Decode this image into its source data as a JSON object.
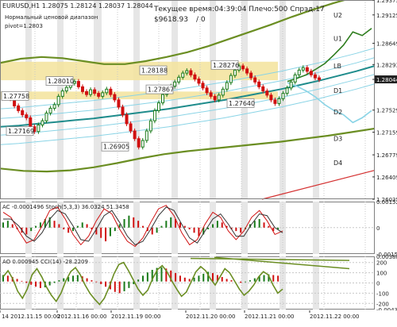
{
  "colors": {
    "bg": "#ffffff",
    "grid": "#c8c8c8",
    "shade": "#e6e6e6",
    "zone": "#f3e39b",
    "text": "#222222",
    "bull": "#1a7a1a",
    "bear": "#d01010",
    "olive": "#6b8e23",
    "teal": "#1f8c8c",
    "lightblue": "#8ad4e6",
    "red": "#d43030",
    "sep": "#808080"
  },
  "header": {
    "symbol_line": "EURUSD,H1  1.28075 1.28124 1.28037 1.28044",
    "indicator_title": "Нормальный ценовой диапазон",
    "pivot_line": "pivot=1.2803",
    "status_time": "Текущее время:04:39:04 Плечо:500 Спрэд:17",
    "balance": "$9618.93",
    "zero": "/ 0"
  },
  "chart_data": [
    {
      "type": "line",
      "title": "EURUSD,H1",
      "ylim": [
        1.26035,
        1.29375
      ],
      "y_ticks": [
        "1.29375",
        "1.29125",
        "1.28649",
        "1.28293",
        "1.28044",
        "1.27529",
        "1.27159",
        "1.26779",
        "1.26409",
        "1.26035"
      ],
      "current_price": "1.28044",
      "x_ticks": [
        "14 2012.11.15 00:00",
        "2012.11.16 00:00",
        "2012.11.19 00:00",
        "2012.11.20 00:00",
        "2012.11.21 00:00",
        "2012.11.22 00:00"
      ],
      "annotations": [
        {
          "label": "1.27758",
          "y": 1.2776
        },
        {
          "label": "1.28010",
          "y": 1.2801
        },
        {
          "label": "1.27169",
          "y": 1.2717
        },
        {
          "label": "1.28188",
          "y": 1.2819
        },
        {
          "label": "1.27867",
          "y": 1.2787
        },
        {
          "label": "1.28276",
          "y": 1.2828
        },
        {
          "label": "1.27640",
          "y": 1.2764
        },
        {
          "label": "1.26905",
          "y": 1.2691
        }
      ],
      "pivot_levels": [
        {
          "name": "U3",
          "y": 1.295
        },
        {
          "name": "U2",
          "y": 1.2912
        },
        {
          "name": "U1",
          "y": 1.2873
        },
        {
          "name": "LB",
          "y": 1.2827
        },
        {
          "name": "D1",
          "y": 1.2786
        },
        {
          "name": "D2",
          "y": 1.275
        },
        {
          "name": "D3",
          "y": 1.2705
        },
        {
          "name": "D4",
          "y": 1.2665
        }
      ],
      "price_zones": [
        {
          "from": 1.2803,
          "to": 1.2834
        },
        {
          "from": 1.2771,
          "to": 1.2784
        }
      ],
      "series": [
        {
          "role": "price",
          "values": [
            1.2775,
            1.2772,
            1.276,
            1.2752,
            1.2745,
            1.274,
            1.2725,
            1.2717,
            1.2728,
            1.2735,
            1.2748,
            1.2756,
            1.2762,
            1.2776,
            1.2785,
            1.2791,
            1.2798,
            1.2801,
            1.2792,
            1.2784,
            1.2779,
            1.2787,
            1.2781,
            1.2776,
            1.2782,
            1.2788,
            1.2779,
            1.277,
            1.2758,
            1.2745,
            1.273,
            1.2718,
            1.2705,
            1.2691,
            1.2702,
            1.2718,
            1.2735,
            1.2752,
            1.2765,
            1.2779,
            1.2787,
            1.2793,
            1.28,
            1.2808,
            1.2815,
            1.2819,
            1.2812,
            1.2805,
            1.2798,
            1.279,
            1.2782,
            1.2776,
            1.277,
            1.2778,
            1.2788,
            1.2799,
            1.2811,
            1.282,
            1.2827,
            1.2822,
            1.2815,
            1.2807,
            1.28,
            1.2792,
            1.2785,
            1.2778,
            1.277,
            1.2764,
            1.2772,
            1.2781,
            1.279,
            1.28,
            1.2812,
            1.282,
            1.2824,
            1.2818,
            1.2812,
            1.2807,
            1.2804
          ]
        },
        {
          "role": "projection_up",
          "values": [
            1.2801,
            1.2806,
            1.2812,
            1.2821,
            1.2831,
            1.2846,
            1.2862,
            1.2884,
            1.2878,
            1.289
          ]
        },
        {
          "role": "projection_down",
          "values": [
            1.2799,
            1.2793,
            1.2785,
            1.2775,
            1.2762,
            1.2752,
            1.2745,
            1.2732,
            1.274,
            1.2752
          ]
        },
        {
          "role": "ma_center",
          "values": [
            1.2725,
            1.2727,
            1.273,
            1.2733,
            1.2736,
            1.2739,
            1.2743,
            1.2747,
            1.2751,
            1.2755,
            1.276,
            1.2765,
            1.277,
            1.2776,
            1.2782,
            1.2788,
            1.2795,
            1.2802,
            1.281,
            1.2818,
            1.2827
          ]
        },
        {
          "role": "upper_band",
          "values": [
            1.2832,
            1.2839,
            1.2842,
            1.284,
            1.2835,
            1.283,
            1.283,
            1.2835,
            1.2842,
            1.285,
            1.286,
            1.2872,
            1.2884,
            1.2896,
            1.2909,
            1.2921,
            1.2932,
            1.2942,
            1.295
          ]
        },
        {
          "role": "lower_band",
          "values": [
            1.2655,
            1.2651,
            1.265,
            1.2652,
            1.2657,
            1.2664,
            1.2672,
            1.2679,
            1.2684,
            1.2688,
            1.2692,
            1.2696,
            1.27,
            1.2705,
            1.271,
            1.2716,
            1.2722
          ]
        }
      ]
    },
    {
      "type": "bar",
      "title": "AC -0.0001496  Stoch(5,3,3) 36.0324 51.3458",
      "ylim": [
        -0.00154,
        0.00152
      ],
      "y_ticks": [
        "0.00152",
        "0",
        "-0.00154"
      ],
      "series": [
        {
          "role": "ac",
          "values": [
            0.0003,
            0.0004,
            0.0002,
            -0.0001,
            -0.0003,
            -0.0004,
            -0.0002,
            0.0001,
            0.0003,
            0.0005,
            0.0006,
            0.0004,
            0.0002,
            -0.0001,
            -0.0003,
            -0.0002,
            0.0001,
            0.0003,
            0.0002,
            -0.0001,
            -0.0004,
            -0.0006,
            -0.0008,
            -0.0005,
            -0.0002,
            0.0002,
            0.0005,
            0.0007,
            0.0006,
            0.0004,
            0.0001,
            -0.0002,
            -0.0004,
            -0.0003,
            0.0001,
            0.0004,
            0.0006,
            0.0005,
            0.0003,
            0.0001,
            -0.0001,
            -0.0003,
            -0.0005,
            -0.0004,
            -0.0001,
            0.0002,
            0.0004,
            0.0003,
            0.0001,
            -0.0001,
            -0.0002,
            -0.0003,
            -0.0001,
            0.0002,
            0.0004,
            0.0005,
            0.0003,
            0.0001,
            -0.0002,
            -0.0001
          ]
        },
        {
          "role": "stoch_main",
          "values": [
            0.0009,
            0.0006,
            -0.0002,
            -0.0009,
            -0.0007,
            0.0001,
            0.001,
            0.0012,
            0.0005,
            -0.0004,
            -0.001,
            -0.0005,
            0.0004,
            0.0011,
            0.0008,
            -0.0001,
            -0.0008,
            -0.0011,
            -0.0006,
            0.0003,
            0.0011,
            0.0013,
            0.0007,
            -0.0003,
            -0.001,
            -0.0007,
            0.0002,
            0.0009,
            0.0006,
            -0.0002,
            -0.0007,
            -0.0002,
            0.0006,
            0.001,
            0.0004,
            -0.0004,
            -0.0002
          ]
        },
        {
          "role": "stoch_signal",
          "values": [
            0.0005,
            0.0005,
            0.0001,
            -0.0005,
            -0.0008,
            -0.0003,
            0.0005,
            0.001,
            0.0008,
            0.0001,
            -0.0007,
            -0.0008,
            -0.0001,
            0.0007,
            0.001,
            0.0003,
            -0.0005,
            -0.001,
            -0.0008,
            -0.0001,
            0.0007,
            0.0012,
            0.001,
            0.0002,
            -0.0006,
            -0.0009,
            -0.0002,
            0.0005,
            0.0008,
            0.0002,
            -0.0005,
            -0.0005,
            0.0002,
            0.0008,
            0.0007,
            0.0,
            -0.0003
          ]
        }
      ]
    },
    {
      "type": "bar",
      "title": "AO 0.000945  CCI(14) -28.2209",
      "ylim": [
        -0.00432,
        0.00388
      ],
      "y_ticks": [
        "0.00388",
        "200",
        "100",
        "0",
        "-100",
        "-200",
        "-0.00432"
      ],
      "series": [
        {
          "role": "ao",
          "values": [
            0.001,
            0.0009,
            0.0007,
            0.0004,
            0.0001,
            -0.0002,
            -0.0005,
            -0.0008,
            -0.001,
            -0.0009,
            -0.0006,
            -0.0002,
            0.0002,
            0.0005,
            0.0007,
            0.0009,
            0.001,
            0.0008,
            0.0005,
            0.0002,
            -0.0001,
            -0.0004,
            -0.0008,
            -0.0012,
            -0.0016,
            -0.0018,
            -0.0015,
            -0.001,
            -0.0004,
            0.0003,
            0.0009,
            0.0014,
            0.0018,
            0.0021,
            0.0022,
            0.002,
            0.0017,
            0.0013,
            0.0009,
            0.0006,
            0.0004,
            0.0006,
            0.0009,
            0.0012,
            0.0015,
            0.0013,
            0.001,
            0.0007,
            0.0004,
            0.0002,
            0.0,
            -0.0002,
            -0.0001,
            0.0002,
            0.0005,
            0.0008,
            0.001,
            0.0011,
            0.001,
            0.0009
          ]
        },
        {
          "role": "cci",
          "values": [
            60,
            120,
            40,
            -80,
            -150,
            -60,
            80,
            140,
            60,
            -40,
            -120,
            -180,
            -100,
            20,
            110,
            150,
            80,
            -20,
            -100,
            -160,
            -210,
            -150,
            -40,
            90,
            180,
            200,
            120,
            30,
            -60,
            -120,
            -70,
            40,
            130,
            170,
            110,
            20,
            -60,
            -130,
            -90,
            10,
            110,
            160,
            120,
            40,
            -20,
            60,
            140,
            100,
            20,
            -60,
            -120,
            -80,
            -20,
            60,
            110,
            80,
            -20,
            -100,
            -60
          ]
        }
      ]
    }
  ]
}
